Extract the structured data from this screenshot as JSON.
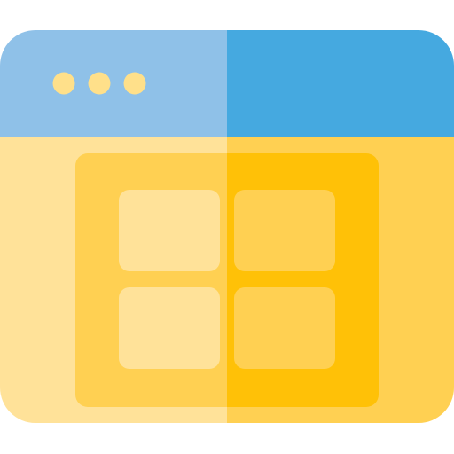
{
  "icon": {
    "name": "browser-window-grid-icon",
    "window": {
      "titlebar_dots": 3,
      "colors": {
        "titlebar_left": "#8FC1E8",
        "titlebar_right": "#45A9E0",
        "dot": "#FFE08A",
        "body_left": "#FFE299",
        "body_right": "#FFD052",
        "panel_left": "#FFD052",
        "panel_right": "#FFC107",
        "tile_left": "#FFE299",
        "tile_right": "#FFD052"
      }
    },
    "grid": {
      "rows": 2,
      "columns": 2
    }
  }
}
